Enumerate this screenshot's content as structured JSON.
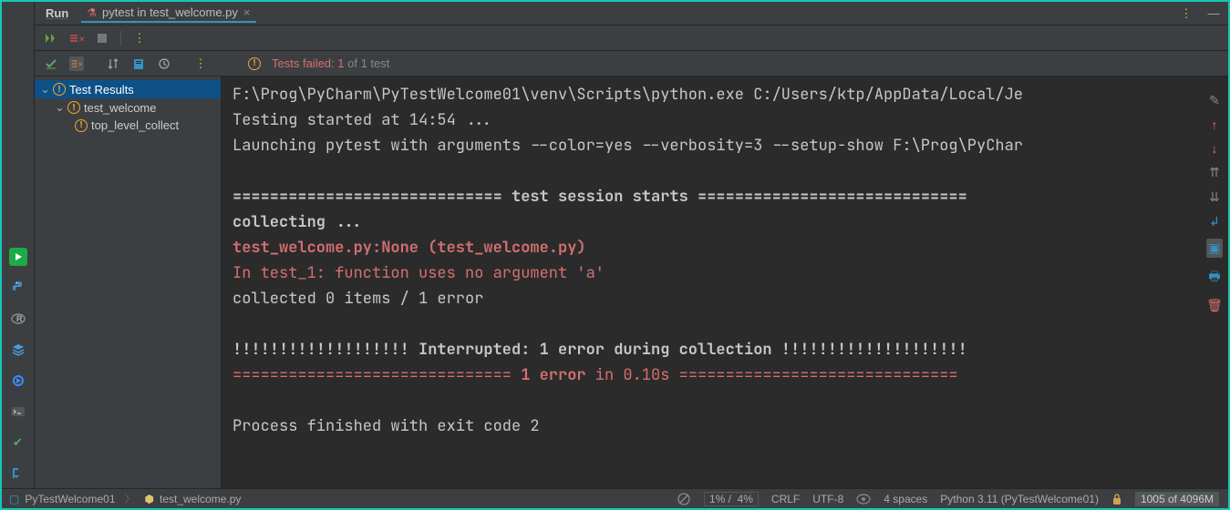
{
  "header": {
    "tool_window_title": "Run",
    "tab_label": "pytest in test_welcome.py"
  },
  "toolbar2": {
    "tests_failed_prefix": "Tests failed: ",
    "tests_failed_count": "1",
    "tests_failed_suffix": " of 1 test"
  },
  "tree": {
    "root": "Test Results",
    "node1": "test_welcome",
    "node2": "top_level_collect"
  },
  "console": {
    "line1": "F:\\Prog\\PyCharm\\PyTestWelcome01\\venv\\Scripts\\python.exe C:/Users/ktp/AppData/Local/Je",
    "line2": "Testing started at 14:54 ...",
    "line3": "Launching pytest with arguments --color=yes --verbosity=3 --setup-show F:\\Prog\\PyChar",
    "sess_eq_l": "=============================",
    "sess_mid": " test session starts ",
    "sess_eq_r": "=============================",
    "collecting": "collecting ... ",
    "err1": "test_welcome.py:None (test_welcome.py)",
    "err2": "In test_1: function uses no argument 'a'",
    "collected": "collected 0 items / 1 error",
    "intr": "!!!!!!!!!!!!!!!!!!! Interrupted: 1 error during collection !!!!!!!!!!!!!!!!!!!!",
    "sum_eq_l": "============================== ",
    "sum_mid": "1 error",
    "sum_in": " in 0.10s",
    "sum_eq_r": " ==============================",
    "exit": "Process finished with exit code 2"
  },
  "statusbar": {
    "project": "PyTestWelcome01",
    "file": "test_welcome.py",
    "pct1": "1%",
    "pct2": "4%",
    "lineend": "CRLF",
    "encoding": "UTF-8",
    "indent": "4 spaces",
    "interpreter": "Python 3.11 (PyTestWelcome01)",
    "mem": "1005 of 4096M"
  }
}
